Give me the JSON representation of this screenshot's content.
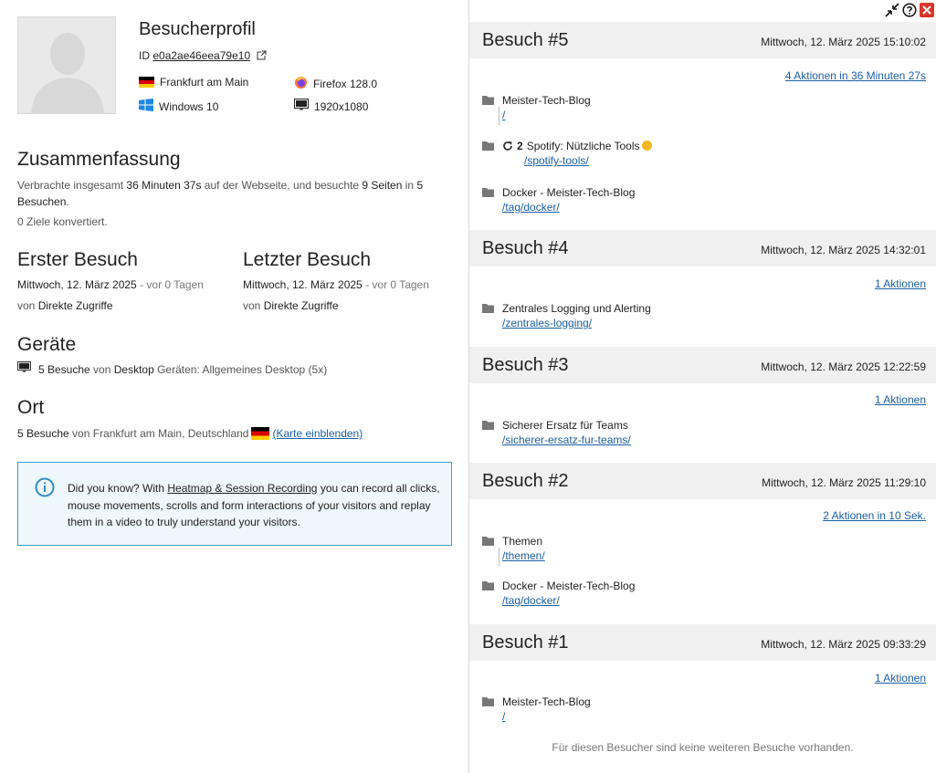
{
  "profile": {
    "title": "Besucherprofil",
    "id_label": "ID",
    "id_value": "e0a2ae46eea79e10",
    "location": "Frankfurt am Main",
    "os": "Windows 10",
    "browser": "Firefox 128.0",
    "resolution": "1920x1080"
  },
  "summary": {
    "heading": "Zusammenfassung",
    "t1": "Verbrachte insgesamt ",
    "duration": "36 Minuten 37s",
    "t2": " auf der Webseite, und besuchte ",
    "pages": "9 Seiten",
    "t3": " in ",
    "visits": "5",
    "t4": "Besuchen",
    "t5": ".",
    "goals": "0 Ziele konvertiert."
  },
  "first_visit": {
    "heading": "Erster Besuch",
    "date": "Mittwoch, 12. März 2025",
    "ago": " - vor 0 Tagen",
    "from": "von ",
    "source": "Direkte Zugriffe"
  },
  "last_visit": {
    "heading": "Letzter Besuch",
    "date": "Mittwoch, 12. März 2025",
    "ago": " - vor 0 Tagen",
    "from": "von ",
    "source": "Direkte Zugriffe"
  },
  "devices": {
    "heading": "Geräte",
    "count": "5 Besuche",
    "from": " von ",
    "type": "Desktop",
    "rest": " Geräten: Allgemeines Desktop (5x)"
  },
  "location": {
    "heading": "Ort",
    "count": "5 Besuche",
    "rest": " von Frankfurt am Main, Deutschland",
    "map_link": "(Karte einblenden)"
  },
  "infobox": {
    "pre": "Did you know? With ",
    "link": "Heatmap & Session Recording",
    "post": " you can record all clicks, mouse movements, scrolls and form interactions of your visitors and replay them in a video to truly understand your visitors."
  },
  "visits": [
    {
      "title": "Besuch #5",
      "date": "Mittwoch, 12. März 2025 15:10:02",
      "actions": "4 Aktionen in 36 Minuten 27s",
      "pages": [
        {
          "title": "Meister-Tech-Blog",
          "url": "/"
        },
        {
          "title": "Spotify: Nützliche Tools",
          "url": "/spotify-tools/",
          "reloads": "2"
        },
        {
          "title": "Docker - Meister-Tech-Blog",
          "url": "/tag/docker/"
        }
      ]
    },
    {
      "title": "Besuch #4",
      "date": "Mittwoch, 12. März 2025 14:32:01",
      "actions": "1 Aktionen",
      "pages": [
        {
          "title": "Zentrales Logging und Alerting",
          "url": "/zentrales-logging/"
        }
      ]
    },
    {
      "title": "Besuch #3",
      "date": "Mittwoch, 12. März 2025 12:22:59",
      "actions": "1 Aktionen",
      "pages": [
        {
          "title": "Sicherer Ersatz für Teams",
          "url": "/sicherer-ersatz-fur-teams/"
        }
      ]
    },
    {
      "title": "Besuch #2",
      "date": "Mittwoch, 12. März 2025 11:29:10",
      "actions": "2 Aktionen in 10 Sek.",
      "pages": [
        {
          "title": "Themen",
          "url": "/themen/"
        },
        {
          "title": "Docker - Meister-Tech-Blog",
          "url": "/tag/docker/"
        }
      ]
    },
    {
      "title": "Besuch #1",
      "date": "Mittwoch, 12. März 2025 09:33:29",
      "actions": "1 Aktionen",
      "pages": [
        {
          "title": "Meister-Tech-Blog",
          "url": "/"
        }
      ]
    }
  ],
  "footer_note": "Für diesen Besucher sind keine weiteren Besuche vorhanden.",
  "colors": {
    "accent": "#1a5fa6",
    "info_border": "#3aa0c6",
    "close": "#d9352a"
  }
}
